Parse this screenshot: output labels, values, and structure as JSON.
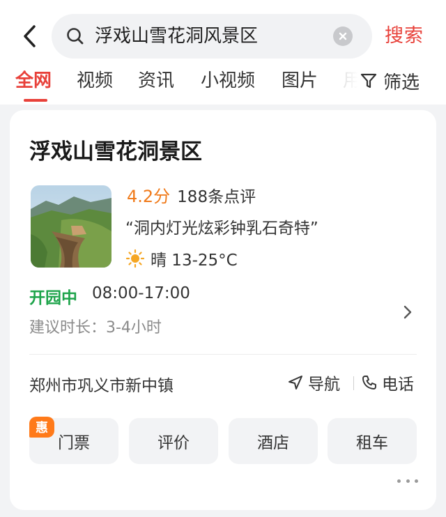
{
  "search": {
    "query": "浮戏山雪花洞风景区",
    "button_label": "搜索"
  },
  "tabs": [
    {
      "label": "全网",
      "active": true
    },
    {
      "label": "视频",
      "active": false
    },
    {
      "label": "资讯",
      "active": false
    },
    {
      "label": "小视频",
      "active": false
    },
    {
      "label": "图片",
      "active": false
    },
    {
      "label": "用",
      "active": false
    }
  ],
  "filter": {
    "label": "筛选",
    "icon": "filter-icon"
  },
  "result": {
    "title": "浮戏山雪花洞景区",
    "score": "4.2分",
    "reviews": "188条点评",
    "quote": "“洞内灯光炫彩钟乳石奇特”",
    "weather": {
      "icon": "sun-icon",
      "text": "晴 13-25°C"
    },
    "status": "开园中",
    "hours": "08:00-17:00",
    "duration": "建议时长：3-4小时",
    "address": "郑州市巩义市新中镇",
    "nav_label": "导航",
    "call_label": "电话",
    "actions": [
      {
        "label": "门票",
        "badge": "惠"
      },
      {
        "label": "评价"
      },
      {
        "label": "酒店"
      },
      {
        "label": "租车"
      }
    ]
  },
  "colors": {
    "accent": "#e8413a",
    "score": "#f07a1a",
    "open": "#1ea44b",
    "badge": "#ff7a1a"
  }
}
